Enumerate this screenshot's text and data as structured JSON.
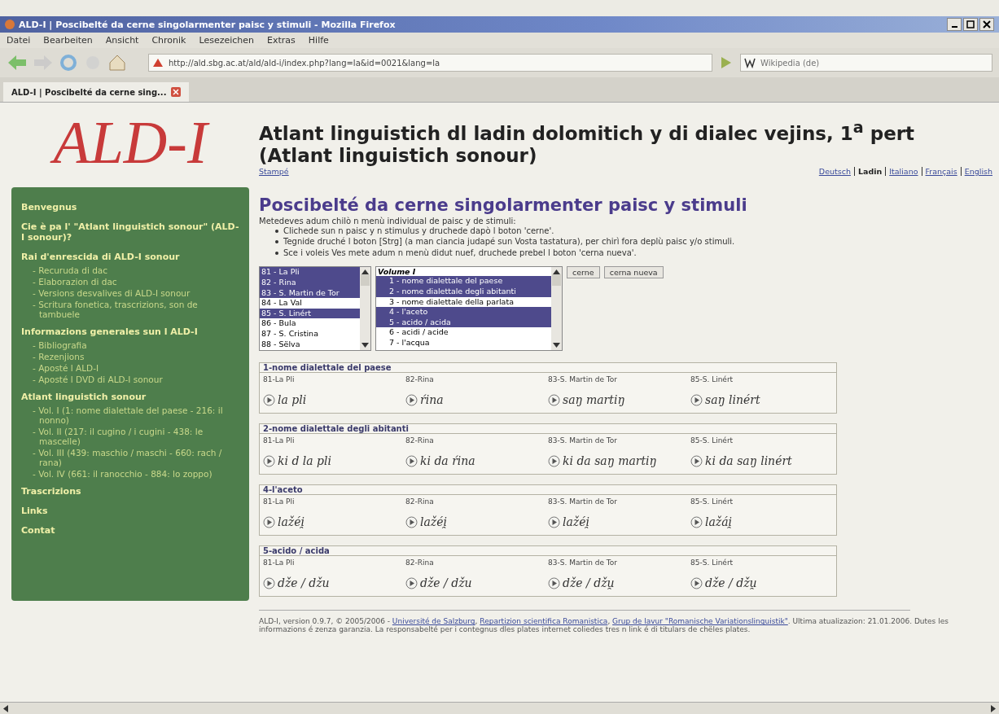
{
  "window": {
    "title": "ALD-I | Poscibelté da cerne singolarmenter paisc y stimuli - Mozilla Firefox"
  },
  "menu": [
    "Datei",
    "Bearbeiten",
    "Ansicht",
    "Chronik",
    "Lesezeichen",
    "Extras",
    "Hilfe"
  ],
  "address": {
    "value": "http://ald.sbg.ac.at/ald/ald-i/index.php?lang=la&id=0021&lang=la"
  },
  "search": {
    "placeholder": "Wikipedia (de)"
  },
  "tabs": [
    {
      "label": "ALD-I | Poscibelté da cerne sing...",
      "selected": true
    }
  ],
  "logo": "ALD-I",
  "page_title": "Atlant linguistich dl ladin dolomitich y di dialec vejins, 1$^{a}$ pert (Atlant linguistich sonour)",
  "print_link": "Stampé",
  "languages": [
    {
      "label": "Deutsch",
      "selected": false
    },
    {
      "label": "Ladin",
      "selected": true
    },
    {
      "label": "Italiano",
      "selected": false
    },
    {
      "label": "Français",
      "selected": false
    },
    {
      "label": "English",
      "selected": false
    }
  ],
  "sidebar": [
    {
      "label": "Benvegnus"
    },
    {
      "label": "Cie è pa l' \"Atlant linguistich sonour\" (ALD-I sonour)?"
    },
    {
      "label": "Rai d'enrescida di ALD-I sonour",
      "children": [
        {
          "label": "- Recuruda di dac"
        },
        {
          "label": "- Elaborazion di dac"
        },
        {
          "label": "- Versions desvalives di ALD-I sonour"
        },
        {
          "label": "- Scritura fonetica, trascrizions, son de tambuele"
        }
      ]
    },
    {
      "label": "Informazions generales sun l ALD-I",
      "children": [
        {
          "label": "- Bibliografia"
        },
        {
          "label": "- Rezenjions"
        },
        {
          "label": "- Aposté l ALD-I"
        },
        {
          "label": "- Aposté l DVD di ALD-I sonour"
        }
      ]
    },
    {
      "label": "Atlant linguistich sonour",
      "children": [
        {
          "label": "- Vol. I (1: nome dialettale del paese - 216: il nonno)"
        },
        {
          "label": "- Vol. II (217: il cugino / i cugini - 438: le mascelle)"
        },
        {
          "label": "- Vol. III (439: maschio / maschi - 660: rach / rana)"
        },
        {
          "label": "- Vol. IV (661: il ranocchio - 884: lo zoppo)"
        }
      ]
    },
    {
      "label": "Trascrizions"
    },
    {
      "label": "Links"
    },
    {
      "label": "Contat"
    }
  ],
  "heading": "Poscibelté da cerne singolarmenter paisc y stimuli",
  "intro": "Metedeves adum chilò n menù individual de paisc y de stimuli:",
  "bullets": [
    "Clichede sun n paisc y n stimulus y druchede dapò l boton 'cerne'.",
    "Tegnide druché l boton [Strg] (a man ciancia judapé sun Vosta tastatura), per chirì fora deplù paisc y/o stimuli.",
    "Sce i voleis Ves mete adum n menù didut nuef, druchede prebel l boton 'cerna nueva'."
  ],
  "places": [
    {
      "label": "81 - La Pli",
      "selected": true
    },
    {
      "label": "82 - Rina",
      "selected": true
    },
    {
      "label": "83 - S. Martin de Tor",
      "selected": true
    },
    {
      "label": "84 - La Val",
      "selected": false
    },
    {
      "label": "85 - S. Linért",
      "selected": true
    },
    {
      "label": "86 - Bula",
      "selected": false
    },
    {
      "label": "87 - S. Cristina",
      "selected": false
    },
    {
      "label": "88 - Sëlva",
      "selected": false
    }
  ],
  "stimuli_group": "Volume I",
  "stimuli": [
    {
      "label": "1 - nome dialettale del paese",
      "selected": true
    },
    {
      "label": "2 - nome dialettale degli abitanti",
      "selected": true
    },
    {
      "label": "3 - nome dialettale della parlata",
      "selected": false
    },
    {
      "label": "4 - l'aceto",
      "selected": true
    },
    {
      "label": "5 - acido / acida",
      "selected": true
    },
    {
      "label": "6 - acidi / acide",
      "selected": false
    },
    {
      "label": "7 - l'acqua",
      "selected": false
    }
  ],
  "buttons": [
    "cerne",
    "cerna nueva"
  ],
  "results": [
    {
      "title": "1-nome dialettale del paese",
      "cells": [
        {
          "place": "81-La Pli",
          "form": "la pli"
        },
        {
          "place": "82-Rina",
          "form": "ŕina"
        },
        {
          "place": "83-S. Martin de Tor",
          "form": "saŋ martiŋ"
        },
        {
          "place": "85-S. Linért",
          "form": "saŋ linért"
        }
      ]
    },
    {
      "title": "2-nome dialettale degli abitanti",
      "cells": [
        {
          "place": "81-La Pli",
          "form": "ki d la pli"
        },
        {
          "place": "82-Rina",
          "form": "ki da ŕina"
        },
        {
          "place": "83-S. Martin de Tor",
          "form": "ki da saŋ martiŋ"
        },
        {
          "place": "85-S. Linért",
          "form": "ki da saŋ linért"
        }
      ]
    },
    {
      "title": "4-l'aceto",
      "cells": [
        {
          "place": "81-La Pli",
          "form": "lažéi̯"
        },
        {
          "place": "82-Rina",
          "form": "lažéi̯"
        },
        {
          "place": "83-S. Martin de Tor",
          "form": "lažéi̯"
        },
        {
          "place": "85-S. Linért",
          "form": "lažái̯"
        }
      ]
    },
    {
      "title": "5-acido / acida",
      "cells": [
        {
          "place": "81-La Pli",
          "form": "dže / džu"
        },
        {
          "place": "82-Rina",
          "form": "dže / džu"
        },
        {
          "place": "83-S. Martin de Tor",
          "form": "dže / džu̯"
        },
        {
          "place": "85-S. Linért",
          "form": "dže / džu̯"
        }
      ]
    }
  ],
  "footer": [
    {
      "text": "ALD-I, version 0.9.7, © 2005/2006 - ",
      "link": false
    },
    {
      "text": "Université de Salzburg",
      "link": true
    },
    {
      "text": ", ",
      "link": false
    },
    {
      "text": "Repartizion scientifica Romanistica",
      "link": true
    },
    {
      "text": ", ",
      "link": false
    },
    {
      "text": "Grup de lavur \"Romanische Variationslinguistik\"",
      "link": true
    },
    {
      "text": ". Ultima atualizazion: 21.01.2006. Dutes les informazions é zenza garanzia. La responsabelté per i contegnus dles plates internet coliedes tres n link é di titulars de chëles plates.",
      "link": false
    }
  ]
}
